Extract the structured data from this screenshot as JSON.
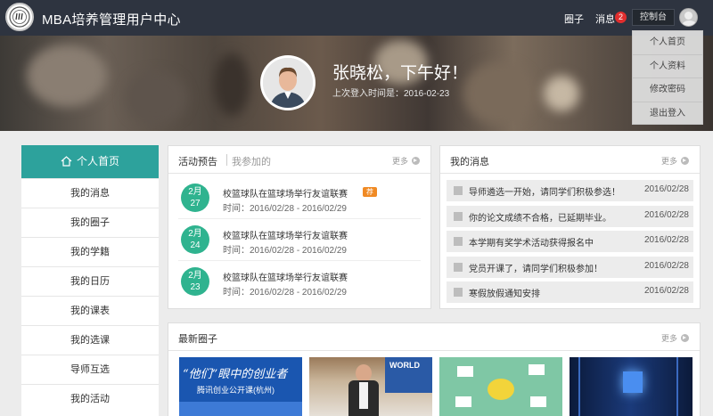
{
  "header": {
    "app_title": "MBA培养管理用户中心",
    "nav_circle": "圈子",
    "nav_messages": "消息",
    "message_badge": "2",
    "control_panel": "控制台"
  },
  "dropdown": {
    "items": [
      "个人首页",
      "个人资料",
      "修改密码",
      "退出登入"
    ]
  },
  "profile": {
    "greeting": "张晓松，下午好！",
    "last_login": "上次登入时间是：2016-02-23"
  },
  "sidebar": {
    "header": "个人首页",
    "items": [
      "我的消息",
      "我的圈子",
      "我的学籍",
      "我的日历",
      "我的课表",
      "我的选课",
      "导师互选",
      "我的活动"
    ]
  },
  "activities": {
    "tab1": "活动预告",
    "tab2": "我参加的",
    "more": "更多",
    "hot_label": "荐",
    "items": [
      {
        "month": "2月",
        "day": "27",
        "title": "校篮球队在篮球场举行友谊联赛",
        "time": "时间：2016/02/28 - 2016/02/29"
      },
      {
        "month": "2月",
        "day": "24",
        "title": "校篮球队在篮球场举行友谊联赛",
        "time": "时间：2016/02/28 - 2016/02/29"
      },
      {
        "month": "2月",
        "day": "23",
        "title": "校篮球队在篮球场举行友谊联赛",
        "time": "时间：2016/02/28 - 2016/02/29"
      }
    ]
  },
  "messages": {
    "title": "我的消息",
    "more": "更多",
    "items": [
      {
        "text": "导师遴选一开始，请同学们积极参选！",
        "date": "2016/02/28"
      },
      {
        "text": "你的论文成绩不合格，已延期毕业。",
        "date": "2016/02/28"
      },
      {
        "text": "本学期有奖学术活动获得报名中",
        "date": "2016/02/28"
      },
      {
        "text": "党员开课了，请同学们积极参加！",
        "date": "2016/02/28"
      },
      {
        "text": "寒假放假通知安排",
        "date": "2016/02/28"
      }
    ]
  },
  "circles": {
    "title": "最新圈子",
    "more": "更多",
    "image1_text": "“他们”眼中的创业者",
    "image1_sub": "腾讯创业公开课(杭州)",
    "image2_text": "WORLD"
  },
  "colors": {
    "topbar": "#2e3440",
    "accent": "#2da29c",
    "date_circle": "#2fb38f",
    "badge": "#e02e2e",
    "hot": "#f08a24"
  }
}
